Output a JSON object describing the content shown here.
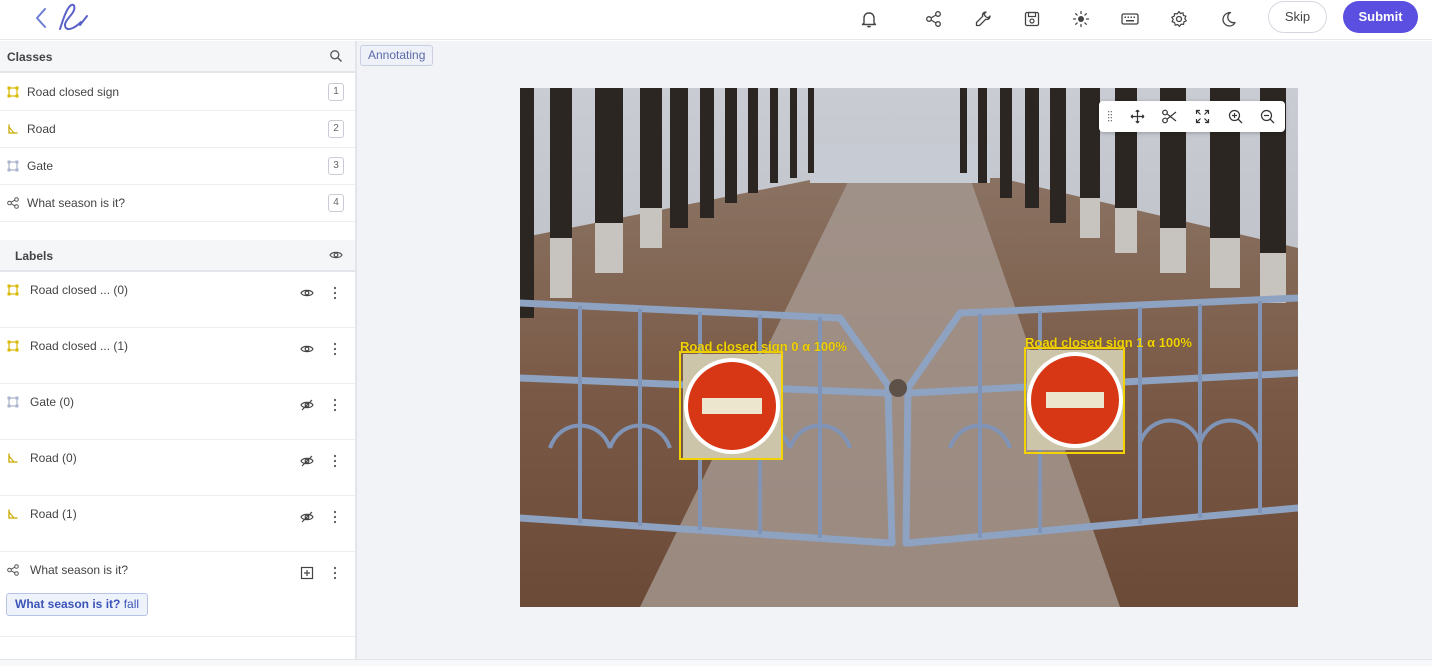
{
  "topbar": {
    "back_icon": "chevron-left-icon",
    "logo_icon": "handwritten-logo-icon",
    "icons": [
      "bell-icon",
      "share-icon",
      "wrench-icon",
      "save-icon",
      "brightness-icon",
      "keyboard-icon",
      "gear-icon",
      "moon-icon"
    ],
    "skip_label": "Skip",
    "submit_label": "Submit",
    "submit_color": "#5a4fe0"
  },
  "classes": {
    "title": "Classes",
    "items": [
      {
        "label": "Road closed sign",
        "key": "1",
        "icon": "bounding-box-icon"
      },
      {
        "label": "Road",
        "key": "2",
        "icon": "polyline-icon"
      },
      {
        "label": "Gate",
        "key": "3",
        "icon": "bounding-box-icon"
      },
      {
        "label": "What season is it?",
        "key": "4",
        "icon": "classification-icon"
      }
    ]
  },
  "labels": {
    "title": "Labels",
    "items": [
      {
        "label": "Road closed ... (0)",
        "visibility": "visible-eye-icon"
      },
      {
        "label": "Road closed ... (1)",
        "visibility": "visible-eye-icon"
      },
      {
        "label": "Gate (0)",
        "visibility": "hidden-eye-icon"
      },
      {
        "label": "Road (0)",
        "visibility": "hidden-eye-icon"
      },
      {
        "label": "Road (1)",
        "visibility": "hidden-eye-icon"
      },
      {
        "label": "What season is it?",
        "visibility": "add-box-icon"
      }
    ],
    "answer": {
      "question": "What season is it?",
      "value": "fall"
    }
  },
  "canvas": {
    "status_badge": "Annotating",
    "toolbar_icons": [
      "drag-handle-icon",
      "move-icon",
      "scissors-icon",
      "fit-screen-icon",
      "zoom-in-icon",
      "zoom-out-icon"
    ],
    "annotations": [
      {
        "label": "Road closed sign 0 α  100%"
      },
      {
        "label": "Road closed sign 1 α  100%"
      }
    ],
    "annotation_color": "#f2d200"
  }
}
